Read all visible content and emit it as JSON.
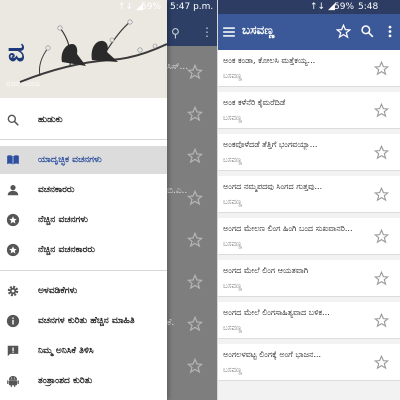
{
  "left": {
    "status": {
      "signal": "↑↓ ◢",
      "battery": "59%",
      "time": "5:47 p.m."
    },
    "drawer": {
      "logo": "ವ",
      "caption": "ವಚನ ಸಂಚಯ",
      "items": [
        {
          "label": "ಹುಡುಕು",
          "icon": "search-icon"
        },
        {
          "label": "ಯಾದೃಚ್ಛಿಕ ವಚನಗಳು",
          "icon": "book-icon"
        },
        {
          "label": "ವಚನಕಾರರು",
          "icon": "person-icon"
        },
        {
          "label": "ನೆಚ್ಚಿನ ವಚನಗಳು",
          "icon": "star-circle-icon"
        },
        {
          "label": "ನೆಚ್ಚಿನ ವಚನಕಾರರು",
          "icon": "star-circle-icon"
        },
        {
          "label": "ಅಳವಡಿಕೆಗಳು",
          "icon": "gear-icon"
        },
        {
          "label": "ವಚನಗಳ ಕುರಿತು ಹೆಚ್ಚಿನ ಮಾಹಿತಿ",
          "icon": "info-icon"
        },
        {
          "label": "ನಿಮ್ಮ ಅನಿಸಿಕೆ ತಿಳಿಸಿ",
          "icon": "feedback-icon"
        },
        {
          "label": "ತಂತ್ರಾಂಶದ ಕುರಿತು",
          "icon": "android-icon"
        }
      ]
    },
    "background_snippets": [
      "ಸಿಸ್...",
      "ಬಿ.ಎ..",
      "ಕೆ."
    ]
  },
  "right": {
    "status": {
      "signal": "↑↓ ◢",
      "battery": "59%",
      "time": "5:48 p.m."
    },
    "appbar": {
      "title": "ಬಸವಣ್ಣ",
      "menu_icon": "menu-icon",
      "star_icon": "star-icon",
      "search_icon": "search-icon",
      "more_icon": "more-vert-icon"
    },
    "rows": [
      {
        "title": "ಅಂಕ ಕಂಡಾ, ಕೋಲಸಿ ಮತ್ತೆಕಯ್ಯ...",
        "author": "ಬಸವಣ್ಣ"
      },
      {
        "title": "ಅಂಕ ಕಳೆನೆರಿ ಕೈಮರೆದಿಡೆ",
        "author": "ಬಸವಣ್ಣ"
      },
      {
        "title": "ಅಂಕವೊಳೆದಡೆ ತೆತ್ತಿಗೆ ಭಂಗವಯ್ಯಾ...",
        "author": "ಬಸವಣ್ಣ"
      },
      {
        "title": "ಅಂಗದ ನಮ್ಮಪದವು ಸಿಂಗದ ಗುತ್ತವು...",
        "author": "ಬಸವಣ್ಣ"
      },
      {
        "title": "ಅಂಗದ ಮೇಲಣ ಲಿಂಗ ಹಿಂಗಿ ಬಂದ ಸುಖವಾನರಿ...",
        "author": "ಬಸವಣ್ಣ"
      },
      {
        "title": "ಅಂಗದ ಮೇಲೆ ಲಿಂಗ ಆಯತವಾಗಿ",
        "author": "ಬಸವಣ್ಣ"
      },
      {
        "title": "ಅಂಗದ ಮೇಲೆ ಲಿಂಗಸಾಹಿತ್ಯವಾದ ಬಳಿಕ...",
        "author": "ಬಸವಣ್ಣ"
      },
      {
        "title": "ಅಂಗಲಳವಟ್ಟ ಲಿಂಗಕ್ಕೆ ಅಂಗೆ ಭಾಜನ...",
        "author": "ಬಸವಣ್ಣ"
      }
    ]
  },
  "colors": {
    "appbar": "#3b5998",
    "statusbar": "#2c3c62",
    "accent": "#2e4f9e",
    "star_outline": "#9a9a9a"
  }
}
